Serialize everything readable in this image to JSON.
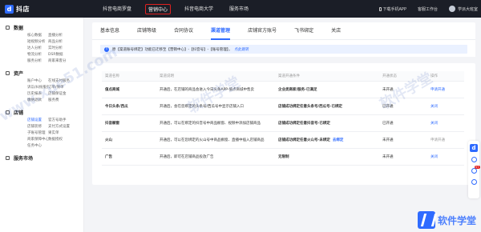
{
  "topnav": {
    "logo_text": "抖店",
    "links": [
      "抖音电商罗盘",
      "营销中心",
      "抖音电商大学",
      "服务市场"
    ],
    "active_link": "营销中心",
    "download": "下载手机APP",
    "workbench": "客服工作台",
    "user": "学派大班室"
  },
  "sidebar": {
    "sections": [
      {
        "title": "数据",
        "items": [
          "核心数据",
          "直播分析",
          "短视频分析",
          "商品分析",
          "达人分析",
          "实时分析",
          "物流分析",
          "DSR数据",
          "服务分析",
          "商家来客分"
        ]
      },
      {
        "title": "资产",
        "items": [
          "账户中心",
          "在线支付服务",
          "诉讼/纠纷服务",
          "订单/保单",
          "历史报表",
          "店铺保证金",
          "缴纳退款",
          "服务费"
        ]
      },
      {
        "title": "店铺",
        "items": [
          "店铺设置",
          "官方号助手",
          "店铺装修",
          "支付方式设置",
          "子账号管理",
          "果实单",
          "商家保障中心",
          "数据授权",
          "任务中心"
        ]
      },
      {
        "title": "服务市场",
        "items": []
      }
    ],
    "active_item": "店铺设置"
  },
  "tabs": {
    "items": [
      "基本信息",
      "店铺等级",
      "合同协议",
      "渠道管理",
      "店铺官方账号",
      "飞书绑定",
      "关店"
    ],
    "active": "渠道管理"
  },
  "notice": {
    "text": "原【渠道账号绑定】功能已迁移至【营销中心】-【抖音号】-【账号管理】，",
    "link": "点此跳转"
  },
  "table": {
    "headers": [
      "渠道名称",
      "渠道说明",
      "渠道开通条件",
      "开通状态",
      "操作"
    ],
    "rows": [
      {
        "name": "值点商城",
        "desc": "开通后，在店铺的商品会进入今日头条APP-值点商城中售卖",
        "cond": "企业类商家/服务-已满足",
        "link": "",
        "status": "未开通",
        "op": "申请开通",
        "op_muted": false
      },
      {
        "name": "今日头条/西瓜",
        "desc": "开通后，会在您绑定的头条号/西瓜号中显示店铺入口",
        "cond": "店铺成功绑定任意头条号/西瓜号-已绑定",
        "link": "",
        "status": "已开通",
        "op": "关闭",
        "op_muted": false
      },
      {
        "name": "抖音橱窗",
        "desc": "开通后，可以在绑定的抖音号中商品橱窗、视频中添加店铺商品",
        "cond": "店铺成功绑定任意抖音号-已绑定",
        "link": "",
        "status": "已开通",
        "op": "关闭",
        "op_muted": false
      },
      {
        "name": "火山",
        "desc": "开通后，可以在您绑定的火山号中商品橱窗、直播中插入店铺商品",
        "cond": "店铺成功绑定任意火山号-未绑定",
        "link": "去绑定",
        "status": "未开通",
        "op": "申请开通",
        "op_muted": true
      },
      {
        "name": "广告",
        "desc": "开通后，即可在店铺商品投放广告",
        "cond": "无限制",
        "link": "",
        "status": "未开通",
        "op": "关闭",
        "op_muted": false
      }
    ]
  },
  "watermark": {
    "brand": "软件学堂",
    "url": "www.xue51.com"
  },
  "colors": {
    "accent": "#2f6bff",
    "nav_bg": "#1b1e27",
    "highlight_box": "#e02020"
  }
}
